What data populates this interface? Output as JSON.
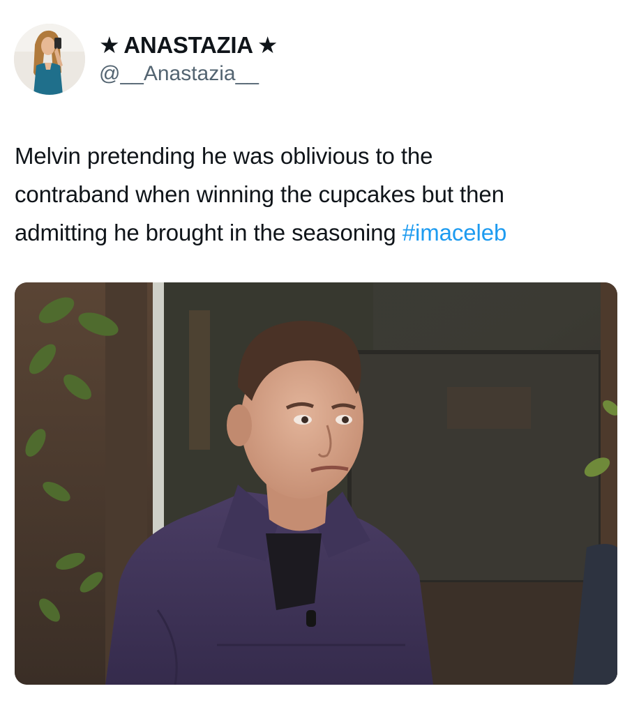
{
  "author": {
    "star_left": "★",
    "name": "ANASTAZIA",
    "star_right": "★",
    "handle": "@__Anastazia__"
  },
  "tweet": {
    "line1": "Melvin pretending he was oblivious to the",
    "line2": "contraband when winning the cupcakes but then",
    "line3_text": "admitting he brought in the seasoning",
    "hashtag": "#imaceleb"
  },
  "colors": {
    "text": "#0f1419",
    "handle": "#536471",
    "hashtag": "#1d9bf0"
  },
  "icons": {
    "star": "black-star"
  }
}
